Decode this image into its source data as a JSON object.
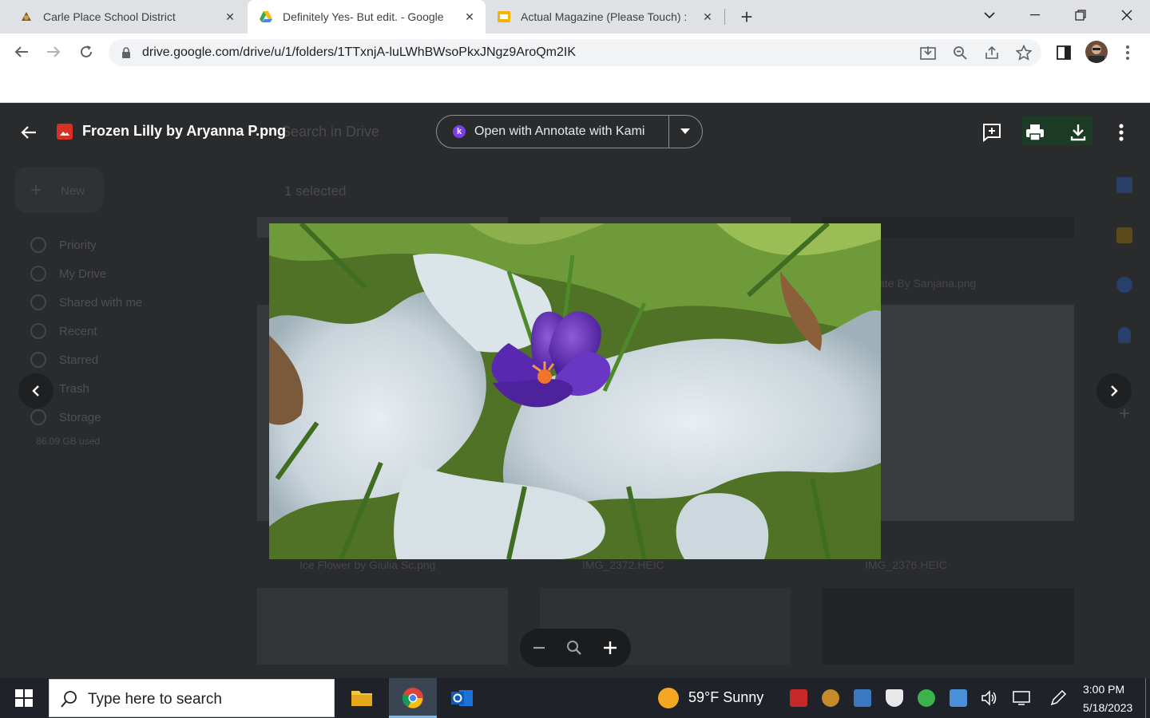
{
  "browser": {
    "tabs": [
      {
        "title": "Carle Place School District",
        "active": false
      },
      {
        "title": "Definitely Yes- But edit. - Google",
        "active": true
      },
      {
        "title": "Actual Magazine (Please Touch) :",
        "active": false
      }
    ],
    "new_tab": "+",
    "close_glyph": "✕",
    "url": "drive.google.com/drive/u/1/folders/1TTxnjA-luLWhBWsoPkxJNgz9AroQm2IK"
  },
  "drive_bg": {
    "search_placeholder": "Search in Drive",
    "new_button": "New",
    "selection_label": "1 selected",
    "nav": [
      "Priority",
      "My Drive",
      "Shared with me",
      "Recent",
      "Starred",
      "Trash",
      "Storage"
    ],
    "storage_used": "86.09 GB used",
    "files": [
      "ate By Sanjana.png",
      "Ice Flower by Giulia Sc.png",
      "IMG_2372.HEIC",
      "IMG_2376.HEIC"
    ]
  },
  "viewer": {
    "file_title": "Frozen Lilly by Aryanna P.png",
    "open_with_label": "Open with Annotate with Kami",
    "kami_letter": "k",
    "colors": {
      "kami": "#7b3fe4",
      "image_badge": "#d93025"
    }
  },
  "taskbar": {
    "search_placeholder": "Type here to search",
    "weather": "59°F  Sunny",
    "time": "3:00 PM",
    "date": "5/18/2023"
  }
}
